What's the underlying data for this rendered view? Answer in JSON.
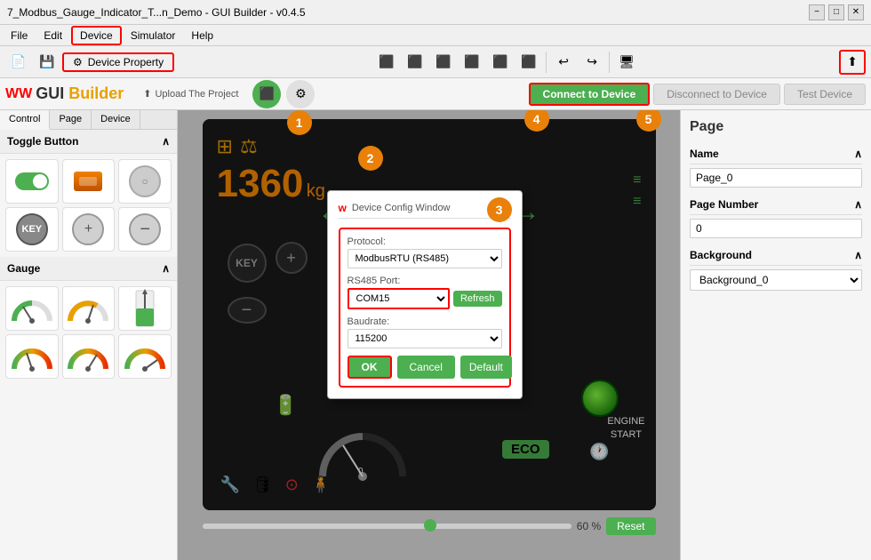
{
  "titlebar": {
    "title": "7_Modbus_Gauge_Indicator_T...n_Demo - GUI Builder - v0.4.5",
    "min": "−",
    "max": "□",
    "close": "✕"
  },
  "menubar": {
    "items": [
      "File",
      "Edit",
      "Device",
      "Simulator",
      "Help"
    ]
  },
  "toolbar": {
    "device_property": "Device Property",
    "upload_project": "Upload The Project"
  },
  "toolbar2": {
    "logo_ww": "WW",
    "logo_text": "GUI Builder",
    "connect_btn": "Connect to Device",
    "disconnect_btn": "Disconnect to Device",
    "test_btn": "Test Device"
  },
  "left_panel": {
    "tabs": [
      "Control",
      "Page",
      "Device"
    ],
    "sections": [
      {
        "title": "Toggle Button",
        "widgets": [
          "toggle-switch",
          "rect-toggle",
          "round-toggle",
          "key-toggle",
          "circle-toggle",
          "minus-toggle"
        ]
      },
      {
        "title": "Gauge",
        "widgets": [
          "gauge1",
          "gauge2",
          "gauge3",
          "gauge4",
          "gauge5",
          "gauge6"
        ]
      }
    ]
  },
  "canvas": {
    "slider_percent": "60 %",
    "reset_btn": "Reset",
    "weight_value": "1360",
    "weight_unit": "kg",
    "engine_start": "ENGINE\nSTART",
    "eco_text": "ECO"
  },
  "modal": {
    "title": "Device Config Window",
    "logo": "w",
    "protocol_label": "Protocol:",
    "protocol_value": "ModbusRTU (RS485)",
    "rs485_label": "RS485 Port:",
    "port_value": "COM15",
    "refresh_btn": "Refresh",
    "baudrate_label": "Baudrate:",
    "baudrate_value": "115200",
    "ok_btn": "OK",
    "cancel_btn": "Cancel",
    "default_btn": "Default"
  },
  "right_panel": {
    "title": "Page",
    "name_label": "Name",
    "name_value": "Page_0",
    "page_number_label": "Page Number",
    "page_number_value": "0",
    "background_label": "Background",
    "background_value": "Background_0"
  },
  "numbered_circles": [
    "1",
    "2",
    "3",
    "4",
    "5"
  ]
}
